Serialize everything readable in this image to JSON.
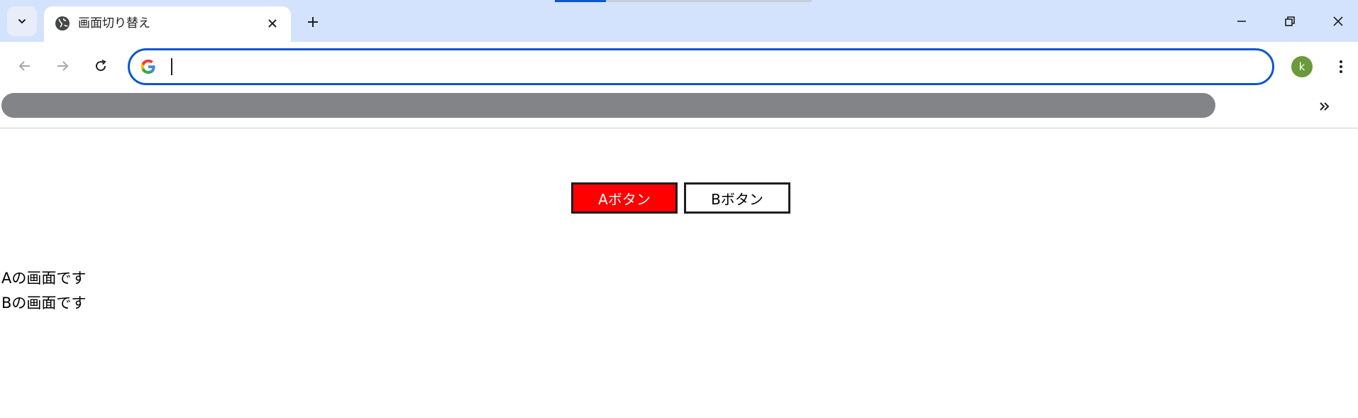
{
  "browser": {
    "tab": {
      "title": "画面切り替え",
      "favicon": "globe-icon",
      "close_icon": "close-icon"
    },
    "new_tab_icon": "plus-icon",
    "window_controls": [
      "minimize-icon",
      "restore-icon",
      "close-icon"
    ],
    "toolbar": {
      "back_icon": "arrow-left-icon",
      "forward_icon": "arrow-right-icon",
      "reload_icon": "reload-icon",
      "omnibox": {
        "value": "",
        "placeholder": "",
        "engine_icon": "google-g-icon"
      },
      "profile_initial": "k",
      "menu_icon": "kebab-icon"
    },
    "bookmarks": {
      "overflow_icon": "double-chevron-right-icon"
    }
  },
  "page": {
    "buttons": [
      {
        "label": "Aボタン",
        "state": "active"
      },
      {
        "label": "Bボタン",
        "state": "inactive"
      }
    ],
    "screens": [
      "Aの画面です",
      "Bの画面です"
    ]
  },
  "colors": {
    "tabstrip_bg": "#d3e3fd",
    "omnibox_focus": "#0b57d0",
    "active_button_bg": "#ff0000",
    "avatar_bg": "#6a9a3a",
    "bookmark_pill": "#838488"
  }
}
